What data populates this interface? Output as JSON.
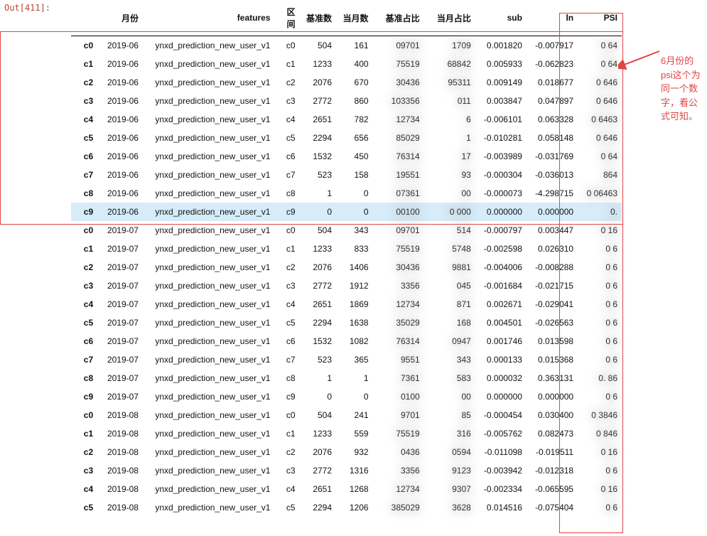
{
  "out_label": "Out[411]:",
  "note_text": "6月份的psi这个为同一个数字，看公式可知。",
  "headers": {
    "idx": "",
    "month": "月份",
    "features": "features",
    "interval": "区间",
    "base_cnt": "基准数",
    "cur_cnt": "当月数",
    "base_pct": "基准占比",
    "cur_pct": "当月占比",
    "sub": "sub",
    "ln": "ln",
    "psi": "PSI"
  },
  "rows": [
    {
      "idx": "c0",
      "month": "2019-06",
      "features": "ynxd_prediction_new_user_v1",
      "interval": "c0",
      "base_cnt": "504",
      "cur_cnt": "161",
      "base_pct": "09701",
      "cur_pct": "1709",
      "sub": "0.001820",
      "ln": "-0.007917",
      "psi": "0    64",
      "hl": false
    },
    {
      "idx": "c1",
      "month": "2019-06",
      "features": "ynxd_prediction_new_user_v1",
      "interval": "c1",
      "base_cnt": "1233",
      "cur_cnt": "400",
      "base_pct": "75519",
      "cur_pct": "68842",
      "sub": "0.005933",
      "ln": "-0.062823",
      "psi": "0    64",
      "hl": false
    },
    {
      "idx": "c2",
      "month": "2019-06",
      "features": "ynxd_prediction_new_user_v1",
      "interval": "c2",
      "base_cnt": "2076",
      "cur_cnt": "670",
      "base_pct": "30436",
      "cur_pct": "95311",
      "sub": "0.009149",
      "ln": "0.018677",
      "psi": "0    646",
      "hl": false
    },
    {
      "idx": "c3",
      "month": "2019-06",
      "features": "ynxd_prediction_new_user_v1",
      "interval": "c3",
      "base_cnt": "2772",
      "cur_cnt": "860",
      "base_pct": "103356",
      "cur_pct": "011",
      "sub": "0.003847",
      "ln": "0.047897",
      "psi": "0    646",
      "hl": false
    },
    {
      "idx": "c4",
      "month": "2019-06",
      "features": "ynxd_prediction_new_user_v1",
      "interval": "c4",
      "base_cnt": "2651",
      "cur_cnt": "782",
      "base_pct": "12734",
      "cur_pct": "6",
      "sub": "-0.006101",
      "ln": "0.063328",
      "psi": "0    6463",
      "hl": false
    },
    {
      "idx": "c5",
      "month": "2019-06",
      "features": "ynxd_prediction_new_user_v1",
      "interval": "c5",
      "base_cnt": "2294",
      "cur_cnt": "656",
      "base_pct": "85029",
      "cur_pct": "1",
      "sub": "-0.010281",
      "ln": "0.058148",
      "psi": "0    646",
      "hl": false
    },
    {
      "idx": "c6",
      "month": "2019-06",
      "features": "ynxd_prediction_new_user_v1",
      "interval": "c6",
      "base_cnt": "1532",
      "cur_cnt": "450",
      "base_pct": "76314",
      "cur_pct": "17",
      "sub": "-0.003989",
      "ln": "-0.031769",
      "psi": "0    64",
      "hl": false
    },
    {
      "idx": "c7",
      "month": "2019-06",
      "features": "ynxd_prediction_new_user_v1",
      "interval": "c7",
      "base_cnt": "523",
      "cur_cnt": "158",
      "base_pct": "19551",
      "cur_pct": "93",
      "sub": "-0.000304",
      "ln": "-0.036013",
      "psi": "    864",
      "hl": false
    },
    {
      "idx": "c8",
      "month": "2019-06",
      "features": "ynxd_prediction_new_user_v1",
      "interval": "c8",
      "base_cnt": "1",
      "cur_cnt": "0",
      "base_pct": "07361",
      "cur_pct": "00",
      "sub": "-0.000073",
      "ln": "-4.298715",
      "psi": "0   06463",
      "hl": false
    },
    {
      "idx": "c9",
      "month": "2019-06",
      "features": "ynxd_prediction_new_user_v1",
      "interval": "c9",
      "base_cnt": "0",
      "cur_cnt": "0",
      "base_pct": "00100",
      "cur_pct": "0     000",
      "sub": "0.000000",
      "ln": "0.000000",
      "psi": "0.",
      "hl": true
    },
    {
      "idx": "c0",
      "month": "2019-07",
      "features": "ynxd_prediction_new_user_v1",
      "interval": "c0",
      "base_cnt": "504",
      "cur_cnt": "343",
      "base_pct": "09701",
      "cur_pct": "514",
      "sub": "-0.000797",
      "ln": "0.003447",
      "psi": "0     16",
      "hl": false
    },
    {
      "idx": "c1",
      "month": "2019-07",
      "features": "ynxd_prediction_new_user_v1",
      "interval": "c1",
      "base_cnt": "1233",
      "cur_cnt": "833",
      "base_pct": "75519",
      "cur_pct": "5748",
      "sub": "-0.002598",
      "ln": "0.026310",
      "psi": "0    6",
      "hl": false
    },
    {
      "idx": "c2",
      "month": "2019-07",
      "features": "ynxd_prediction_new_user_v1",
      "interval": "c2",
      "base_cnt": "2076",
      "cur_cnt": "1406",
      "base_pct": "30436",
      "cur_pct": "9881",
      "sub": "-0.004006",
      "ln": "-0.008288",
      "psi": "0    6",
      "hl": false
    },
    {
      "idx": "c3",
      "month": "2019-07",
      "features": "ynxd_prediction_new_user_v1",
      "interval": "c3",
      "base_cnt": "2772",
      "cur_cnt": "1912",
      "base_pct": "3356",
      "cur_pct": "045",
      "sub": "-0.001684",
      "ln": "-0.021715",
      "psi": "0    6",
      "hl": false
    },
    {
      "idx": "c4",
      "month": "2019-07",
      "features": "ynxd_prediction_new_user_v1",
      "interval": "c4",
      "base_cnt": "2651",
      "cur_cnt": "1869",
      "base_pct": "12734",
      "cur_pct": "871",
      "sub": "0.002671",
      "ln": "-0.029041",
      "psi": "0    6",
      "hl": false
    },
    {
      "idx": "c5",
      "month": "2019-07",
      "features": "ynxd_prediction_new_user_v1",
      "interval": "c5",
      "base_cnt": "2294",
      "cur_cnt": "1638",
      "base_pct": "35029",
      "cur_pct": "168",
      "sub": "0.004501",
      "ln": "-0.026563",
      "psi": "0    6",
      "hl": false
    },
    {
      "idx": "c6",
      "month": "2019-07",
      "features": "ynxd_prediction_new_user_v1",
      "interval": "c6",
      "base_cnt": "1532",
      "cur_cnt": "1082",
      "base_pct": "76314",
      "cur_pct": "0947",
      "sub": "0.001746",
      "ln": "0.013598",
      "psi": "0    6",
      "hl": false
    },
    {
      "idx": "c7",
      "month": "2019-07",
      "features": "ynxd_prediction_new_user_v1",
      "interval": "c7",
      "base_cnt": "523",
      "cur_cnt": "365",
      "base_pct": "9551",
      "cur_pct": "343",
      "sub": "0.000133",
      "ln": "0.015368",
      "psi": "0    6",
      "hl": false
    },
    {
      "idx": "c8",
      "month": "2019-07",
      "features": "ynxd_prediction_new_user_v1",
      "interval": "c8",
      "base_cnt": "1",
      "cur_cnt": "1",
      "base_pct": "7361",
      "cur_pct": "583",
      "sub": "0.000032",
      "ln": "0.363131",
      "psi": "0.   86",
      "hl": false
    },
    {
      "idx": "c9",
      "month": "2019-07",
      "features": "ynxd_prediction_new_user_v1",
      "interval": "c9",
      "base_cnt": "0",
      "cur_cnt": "0",
      "base_pct": "0100",
      "cur_pct": "00",
      "sub": "0.000000",
      "ln": "0.000000",
      "psi": "0    6",
      "hl": false
    },
    {
      "idx": "c0",
      "month": "2019-08",
      "features": "ynxd_prediction_new_user_v1",
      "interval": "c0",
      "base_cnt": "504",
      "cur_cnt": "241",
      "base_pct": "9701",
      "cur_pct": "85",
      "sub": "-0.000454",
      "ln": "0.030400",
      "psi": "0   3846",
      "hl": false
    },
    {
      "idx": "c1",
      "month": "2019-08",
      "features": "ynxd_prediction_new_user_v1",
      "interval": "c1",
      "base_cnt": "1233",
      "cur_cnt": "559",
      "base_pct": "75519",
      "cur_pct": "316",
      "sub": "-0.005762",
      "ln": "0.082473",
      "psi": "0   846",
      "hl": false
    },
    {
      "idx": "c2",
      "month": "2019-08",
      "features": "ynxd_prediction_new_user_v1",
      "interval": "c2",
      "base_cnt": "2076",
      "cur_cnt": "932",
      "base_pct": "0436",
      "cur_pct": "0594",
      "sub": "-0.011098",
      "ln": "-0.019511",
      "psi": "0    16",
      "hl": false
    },
    {
      "idx": "c3",
      "month": "2019-08",
      "features": "ynxd_prediction_new_user_v1",
      "interval": "c3",
      "base_cnt": "2772",
      "cur_cnt": "1316",
      "base_pct": "3356",
      "cur_pct": "9123",
      "sub": "-0.003942",
      "ln": "-0.012318",
      "psi": "0    6",
      "hl": false
    },
    {
      "idx": "c4",
      "month": "2019-08",
      "features": "ynxd_prediction_new_user_v1",
      "interval": "c4",
      "base_cnt": "2651",
      "cur_cnt": "1268",
      "base_pct": "12734",
      "cur_pct": "9307",
      "sub": "-0.002334",
      "ln": "-0.065595",
      "psi": "0    16",
      "hl": false
    },
    {
      "idx": "c5",
      "month": "2019-08",
      "features": "ynxd_prediction_new_user_v1",
      "interval": "c5",
      "base_cnt": "2294",
      "cur_cnt": "1206",
      "base_pct": "385029",
      "cur_pct": "3628",
      "sub": "0.014516",
      "ln": "-0.075404",
      "psi": "0    6",
      "hl": false
    }
  ]
}
